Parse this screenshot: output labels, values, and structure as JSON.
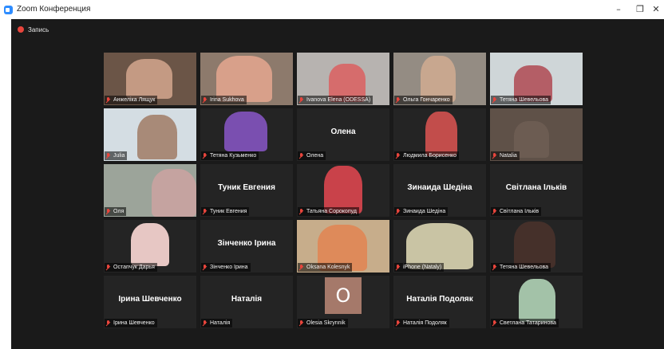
{
  "window": {
    "title": "Zoom Конференция"
  },
  "window_controls": {
    "minimize": "–",
    "maximize": "❐",
    "close": "✕"
  },
  "recording": {
    "label": "Запись"
  },
  "participants": [
    {
      "label": "Анжеліка Лящук",
      "video": true
    },
    {
      "label": "Irina Sukhova",
      "video": true,
      "speaking": true
    },
    {
      "label": "Ivanova Elena (ODESSA)",
      "video": true
    },
    {
      "label": "Ольга Гончаренко",
      "video": true
    },
    {
      "label": "Тетяна Шевельова",
      "video": true
    },
    {
      "label": "Julia",
      "video": true
    },
    {
      "label": "Тетяна Кузьменко",
      "video": true
    },
    {
      "label": "Олена",
      "video": false,
      "display_name": "Олена"
    },
    {
      "label": "Людмила Борисенко",
      "video": true
    },
    {
      "label": "Natalia",
      "video": true
    },
    {
      "label": "Оля",
      "video": true
    },
    {
      "label": "Туник Евгения",
      "video": false,
      "display_name": "Туник Евгения"
    },
    {
      "label": "Татьяна Сорокопуд",
      "video": true
    },
    {
      "label": "Зинаида Шедіна",
      "video": false,
      "display_name": "Зинаида Шедіна"
    },
    {
      "label": "Світлана Ільків",
      "video": false,
      "display_name": "Світлана Ільків"
    },
    {
      "label": "Остапчук Дарья",
      "video": true
    },
    {
      "label": "Зінченко Ірина",
      "video": false,
      "display_name": "Зінченко Ірина"
    },
    {
      "label": "Oksana Kolesnyk",
      "video": true
    },
    {
      "label": "iPhone (Nataly)",
      "video": true
    },
    {
      "label": "Тетяна Шевельова",
      "video": true
    },
    {
      "label": "Ірина Шевченко",
      "video": false,
      "display_name": "Ірина Шевченко"
    },
    {
      "label": "Наталія",
      "video": false,
      "display_name": "Наталія"
    },
    {
      "label": "Olesia Skrynnik",
      "video": false,
      "avatar_letter": "O"
    },
    {
      "label": "Наталія Подоляк",
      "video": false,
      "display_name": "Наталія Подоляк"
    },
    {
      "label": "Светлана Татаринова",
      "video": true
    }
  ]
}
